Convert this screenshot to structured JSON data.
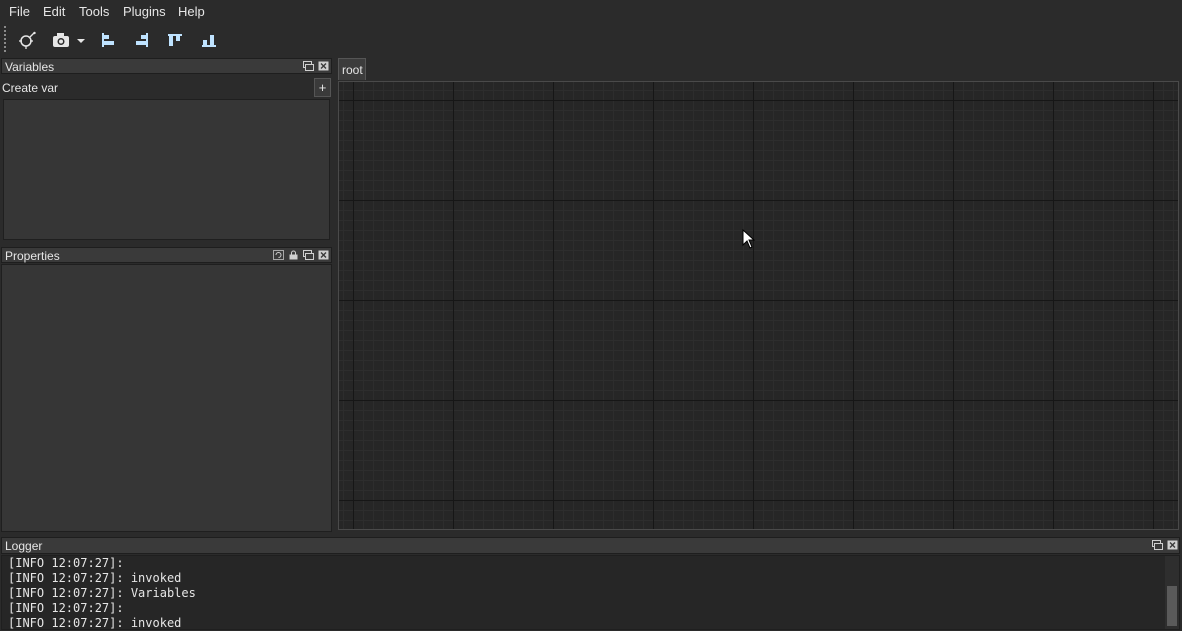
{
  "menu": {
    "items": [
      {
        "label": "File"
      },
      {
        "label": "Edit"
      },
      {
        "label": "Tools"
      },
      {
        "label": "Plugins"
      },
      {
        "label": "Help"
      }
    ]
  },
  "toolbar": {
    "icons": [
      "select-tool-icon",
      "screenshot-camera-icon",
      "dropdown-arrow-icon",
      "align-left-icon",
      "align-right-icon",
      "align-top-icon",
      "align-bottom-icon"
    ]
  },
  "variables": {
    "title": "Variables",
    "create_label": "Create var",
    "add_button": "+"
  },
  "properties": {
    "title": "Properties"
  },
  "graph": {
    "tab_label": "root"
  },
  "logger": {
    "title": "Logger",
    "lines": [
      "[INFO 12:07:27]:",
      "[INFO 12:07:27]: invoked",
      "[INFO 12:07:27]: Variables",
      "[INFO 12:07:27]:",
      "[INFO 12:07:27]: invoked"
    ]
  },
  "colors": {
    "window_bg": "#2b2b2b",
    "canvas_bg": "#262626",
    "icon_blue": "#bfe3ff"
  }
}
